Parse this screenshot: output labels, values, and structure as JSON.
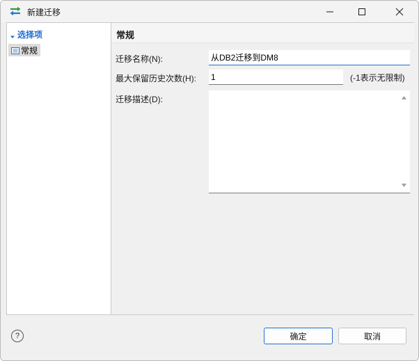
{
  "window": {
    "title": "新建迁移",
    "minimize_glyph": "—",
    "maximize_glyph": "☐",
    "close_glyph": "✕"
  },
  "sidebar": {
    "root_label": "选择项",
    "items": [
      {
        "label": "常规",
        "selected": true
      }
    ]
  },
  "main": {
    "section_title": "常规",
    "fields": {
      "name_label": "迁移名称(N):",
      "name_value": "从DB2迁移到DM8",
      "history_label": "最大保留历史次数(H):",
      "history_value": "1",
      "history_hint": "(-1表示无限制)",
      "desc_label": "迁移描述(D):",
      "desc_value": ""
    }
  },
  "footer": {
    "help_glyph": "?",
    "ok_label": "确定",
    "cancel_label": "取消"
  },
  "colors": {
    "accent": "#1f6fd1",
    "window_bg": "#f0f0f0",
    "panel_bg": "#ffffff",
    "selection_bg": "#dcdcdc"
  },
  "icons": {
    "app": "transfer-arrows-icon",
    "tree_expand": "triangle-down-icon",
    "tree_item": "page-icon",
    "help": "question-circle-icon"
  }
}
